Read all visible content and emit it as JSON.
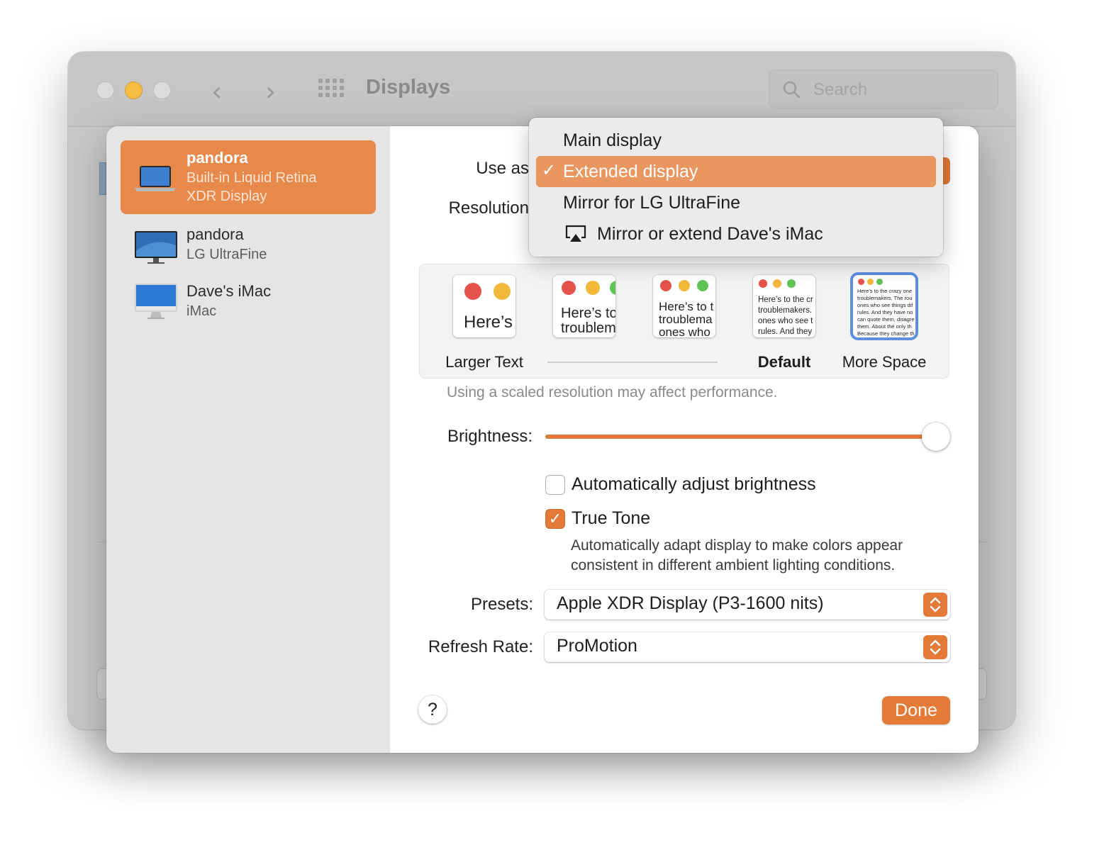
{
  "window": {
    "title": "Displays",
    "search_placeholder": "Search"
  },
  "sidebar": {
    "items": [
      {
        "name": "pandora",
        "sub1": "Built-in Liquid Retina",
        "sub2": "XDR Display",
        "icon": "laptop-icon",
        "selected": true
      },
      {
        "name": "pandora",
        "sub1": "LG UltraFine",
        "icon": "monitor-icon",
        "selected": false
      },
      {
        "name": "Dave's iMac",
        "sub1": "iMac",
        "icon": "imac-icon",
        "selected": false
      }
    ]
  },
  "settings": {
    "use_as_label": "Use as",
    "resolution_label": "Resolution",
    "resolution_options": [
      {
        "caption": "Larger Text",
        "sample": "Here’s"
      },
      {
        "caption": "",
        "sample": "Here’s to\ntroublem"
      },
      {
        "caption": "",
        "sample": "Here’s to t\ntroublema\nones who"
      },
      {
        "caption": "Default",
        "sample": "Here’s to the cr\ntroublemakers.\nones who see t\nrules. And they"
      },
      {
        "caption": "More Space",
        "sample": "Here’s to the crazy one\ntroublemakers. The rou\nones who see things dif\nrules. And they have no\ncan quote them, disagre\nthem. About the only th\nBecause they change th"
      }
    ],
    "performance_note": "Using a scaled resolution may affect performance.",
    "brightness_label": "Brightness:",
    "brightness_value": 0.98,
    "auto_brightness_label": "Automatically adjust brightness",
    "auto_brightness_checked": false,
    "true_tone_label": "True Tone",
    "true_tone_checked": true,
    "true_tone_desc_1": "Automatically adapt display to make colors appear",
    "true_tone_desc_2": "consistent in different ambient lighting conditions.",
    "presets_label": "Presets:",
    "presets_value": "Apple XDR Display (P3-1600 nits)",
    "refresh_label": "Refresh Rate:",
    "refresh_value": "ProMotion",
    "help_label": "?",
    "done_label": "Done"
  },
  "use_as_menu": {
    "items": [
      {
        "label": "Main display",
        "selected": false
      },
      {
        "label": "Extended display",
        "selected": true
      },
      {
        "label": "Mirror for LG UltraFine",
        "selected": false
      },
      {
        "label": "Mirror or extend Dave's iMac",
        "selected": false,
        "icon": "airplay-icon"
      }
    ],
    "check_mark": "✓"
  },
  "colors": {
    "accent": "#e37a37",
    "sidebar_selected": "#e8894c",
    "menu_selected": "#e99660",
    "focus_ring": "#5c8fe0"
  }
}
